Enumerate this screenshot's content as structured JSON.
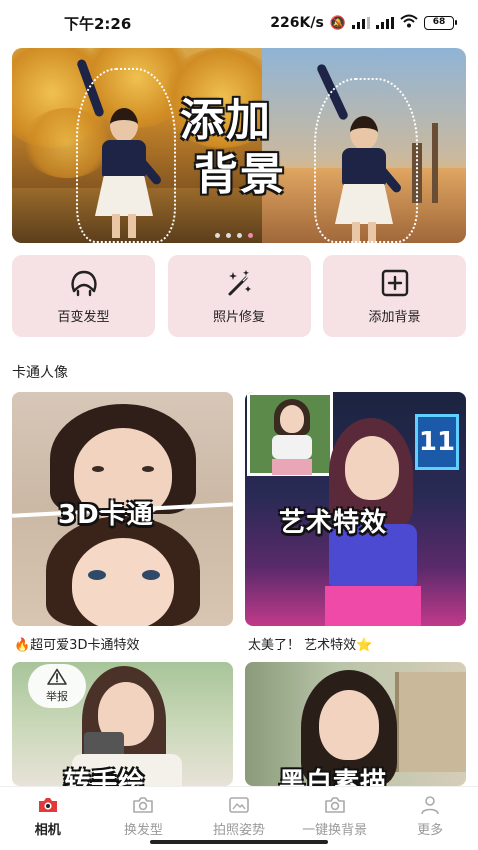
{
  "status_bar": {
    "time": "下午2:26",
    "network_speed": "226K/s",
    "battery": "68"
  },
  "banner": {
    "title_line1": "添加",
    "title_line2": "背景",
    "page_count": 4,
    "active_page": 4
  },
  "tools": [
    {
      "label": "百变发型",
      "icon": "hair-icon"
    },
    {
      "label": "照片修复",
      "icon": "magic-wand-icon"
    },
    {
      "label": "添加背景",
      "icon": "plus-square-icon"
    }
  ],
  "section": {
    "title": "卡通人像"
  },
  "cards": [
    {
      "overlay": "3D卡通",
      "caption": "🔥超可爱3D卡通特效"
    },
    {
      "overlay": "艺术特效",
      "caption": "太美了！ 艺术特效⭐"
    },
    {
      "overlay": "转手绘"
    },
    {
      "overlay": "黑白素描"
    }
  ],
  "report": {
    "label": "举报"
  },
  "bottom_nav": [
    {
      "label": "相机",
      "icon": "camera-icon",
      "active": true
    },
    {
      "label": "换发型",
      "icon": "camera-outline-icon",
      "active": false
    },
    {
      "label": "拍照姿势",
      "icon": "image-icon",
      "active": false
    },
    {
      "label": "一键换背景",
      "icon": "camera-outline-icon",
      "active": false
    },
    {
      "label": "更多",
      "icon": "user-icon",
      "active": false
    }
  ],
  "colors": {
    "tool_bg": "#f6e1e4",
    "accent_pink": "#f08aa8",
    "nav_active": "#222222",
    "nav_inactive": "#9a9a9a",
    "camera_red": "#e23a3a"
  }
}
